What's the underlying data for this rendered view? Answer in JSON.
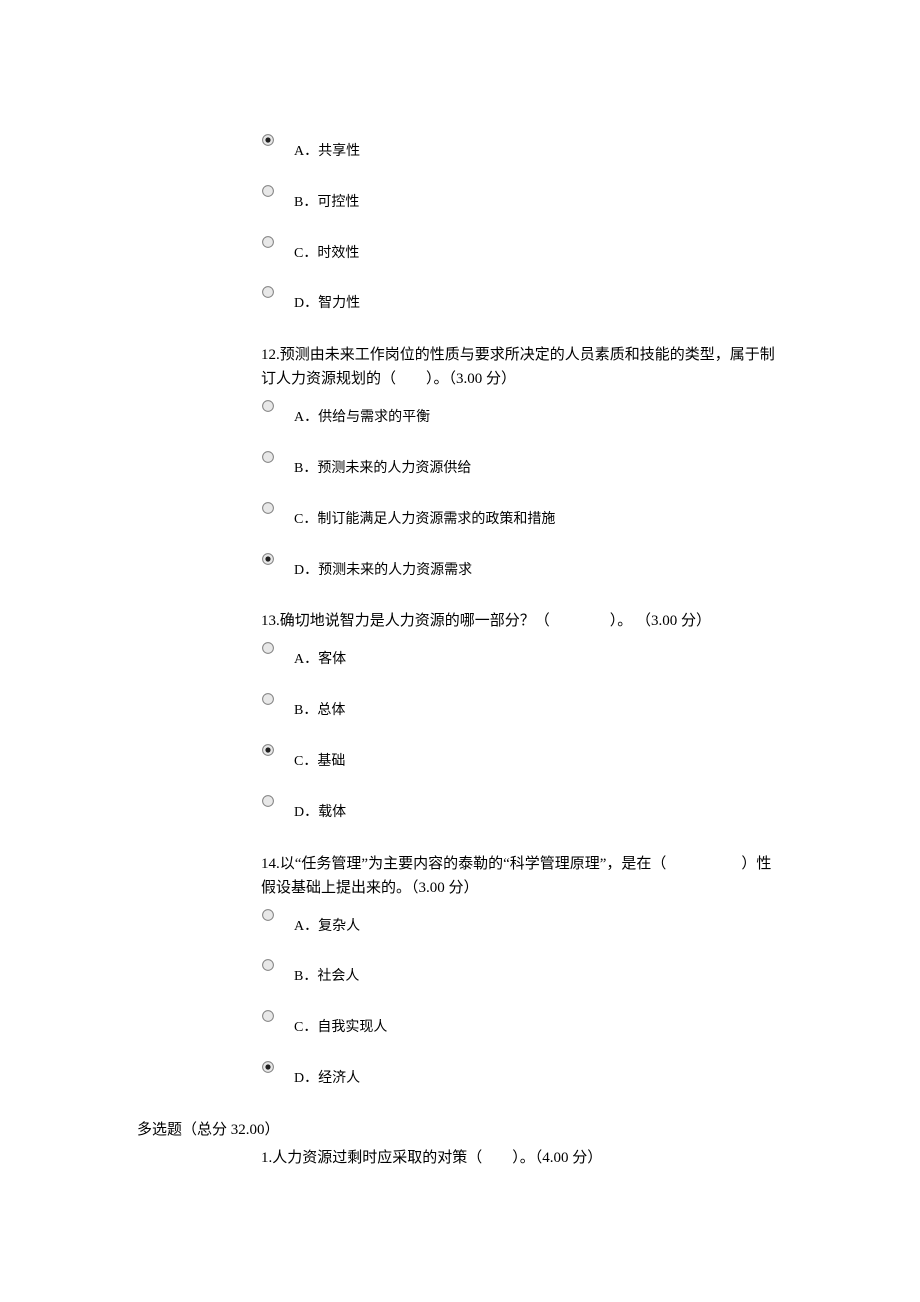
{
  "questions": [
    {
      "stem": "",
      "options": [
        {
          "text": "A．共享性",
          "selected": true
        },
        {
          "text": "B．可控性",
          "selected": false
        },
        {
          "text": "C．时效性",
          "selected": false
        },
        {
          "text": "D．智力性",
          "selected": false
        }
      ]
    },
    {
      "stem": "12.预测由未来工作岗位的性质与要求所决定的人员素质和技能的类型，属于制订人力资源规划的（　　）。（3.00 分）",
      "options": [
        {
          "text": "A．供给与需求的平衡",
          "selected": false
        },
        {
          "text": "B．预测未来的人力资源供给",
          "selected": false
        },
        {
          "text": "C．制订能满足人力资源需求的政策和措施",
          "selected": false
        },
        {
          "text": "D．预测未来的人力资源需求",
          "selected": true
        }
      ]
    },
    {
      "stem": "13.确切地说智力是人力资源的哪一部分？（　　　　）。 （3.00 分）",
      "options": [
        {
          "text": "A．客体",
          "selected": false
        },
        {
          "text": "B．总体",
          "selected": false
        },
        {
          "text": "C．基础",
          "selected": true
        },
        {
          "text": "D．载体",
          "selected": false
        }
      ]
    },
    {
      "stem": "14.以“任务管理”为主要内容的泰勒的“科学管理原理”，是在（　　　　　）性假设基础上提出来的。（3.00 分）",
      "options": [
        {
          "text": "A．复杂人",
          "selected": false
        },
        {
          "text": "B．社会人",
          "selected": false
        },
        {
          "text": "C．自我实现人",
          "selected": false
        },
        {
          "text": "D．经济人",
          "selected": true
        }
      ]
    }
  ],
  "section_heading": "多选题（总分 32.00）",
  "final_question_stem": "1.人力资源过剩时应采取的对策（　　）。（4.00 分）"
}
